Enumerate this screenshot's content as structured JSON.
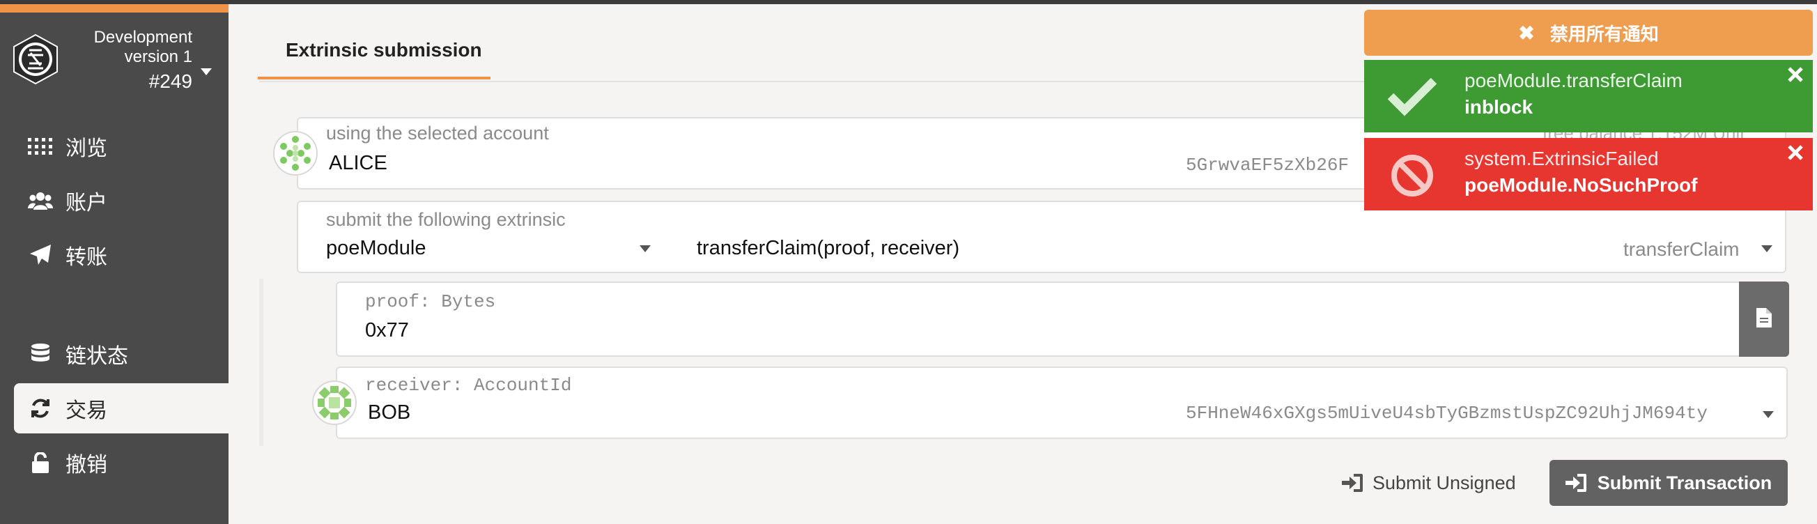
{
  "sidebar": {
    "chain": {
      "name": "Development",
      "version": "version 1",
      "block": "#249"
    },
    "items": [
      {
        "label": "浏览",
        "icon": "grid-dots-icon"
      },
      {
        "label": "账户",
        "icon": "users-icon"
      },
      {
        "label": "转账",
        "icon": "paper-plane-icon"
      },
      {
        "label": "链状态",
        "icon": "database-icon"
      },
      {
        "label": "交易",
        "icon": "sync-icon"
      },
      {
        "label": "撤销",
        "icon": "unlock-icon"
      }
    ]
  },
  "tabs": {
    "active_label": "Extrinsic submission"
  },
  "account": {
    "label": "using the selected account",
    "value": "ALICE",
    "address": "5GrwvaEF5zXb26F",
    "balance_hint": "free balance 1.152M Unit"
  },
  "extrinsic": {
    "label": "submit the following extrinsic",
    "module": "poeModule",
    "method_signature": "transferClaim(proof, receiver)",
    "method": "transferClaim"
  },
  "params": {
    "proof_label": "proof: Bytes",
    "proof_value": "0x77",
    "receiver_label": "receiver: AccountId",
    "receiver_value": "BOB",
    "receiver_address": "5FHneW46xGXgs5mUiveU4sbTyGBzmstUspZC92UhjJM694ty"
  },
  "actions": {
    "unsigned_label": "Submit Unsigned",
    "submit_label": "Submit Transaction"
  },
  "notifications": {
    "disable_label": "禁用所有通知",
    "items": [
      {
        "title": "poeModule.transferClaim",
        "status": "inblock",
        "kind": "success",
        "color": "#3e9b34"
      },
      {
        "title": "system.ExtrinsicFailed",
        "status": "poeModule.NoSuchProof",
        "kind": "error",
        "color": "#e6362f"
      }
    ]
  },
  "colors": {
    "accent": "#ef9346",
    "sidebar": "#4a4a4a"
  }
}
